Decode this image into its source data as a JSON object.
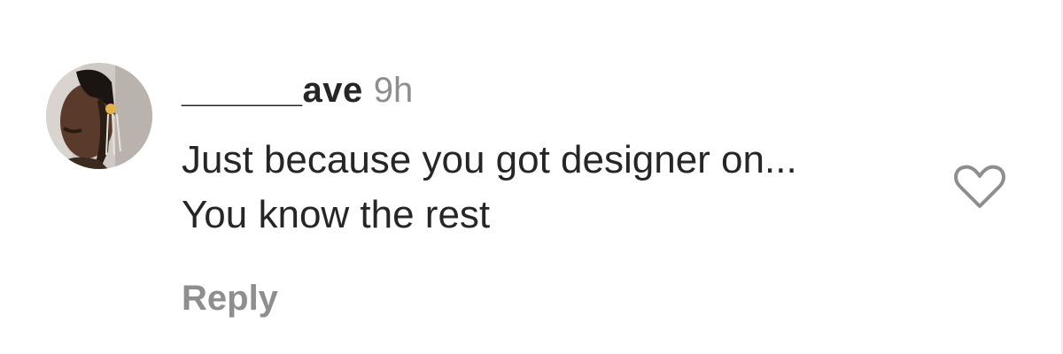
{
  "comment": {
    "username": "______ave",
    "timestamp": "9h",
    "text_lines": [
      "Just because you got designer on...",
      "You know the rest"
    ],
    "reply_label": "Reply",
    "like_icon": "heart-outline-icon",
    "avatar_icon": "user-avatar"
  },
  "colors": {
    "primary_text": "#262626",
    "secondary_text": "#8e8e8e",
    "background": "#ffffff"
  }
}
